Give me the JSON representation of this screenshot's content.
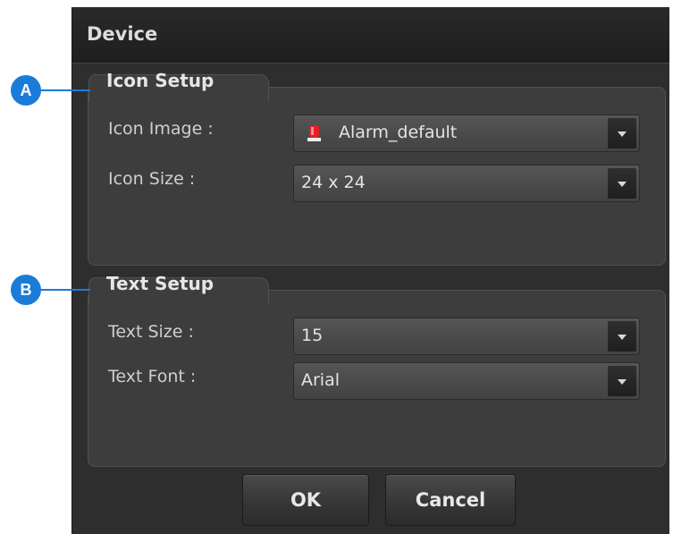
{
  "dialog": {
    "title": "Device",
    "icon_setup": {
      "legend": "Icon Setup",
      "fields": [
        {
          "label": "Icon Image :",
          "value": "Alarm_default",
          "icon": "alarm-light-icon"
        },
        {
          "label": "Icon Size :",
          "value": "24 x 24"
        }
      ]
    },
    "text_setup": {
      "legend": "Text Setup",
      "fields": [
        {
          "label": "Text Size :",
          "value": "15"
        },
        {
          "label": "Text Font :",
          "value": "Arial"
        }
      ]
    },
    "buttons": {
      "ok": "OK",
      "cancel": "Cancel"
    }
  },
  "callouts": {
    "a": "A",
    "b": "B"
  },
  "colors": {
    "callout": "#1a7cd8",
    "dialog_bg": "#2e2e2e",
    "alarm_icon": "#e0202a"
  }
}
